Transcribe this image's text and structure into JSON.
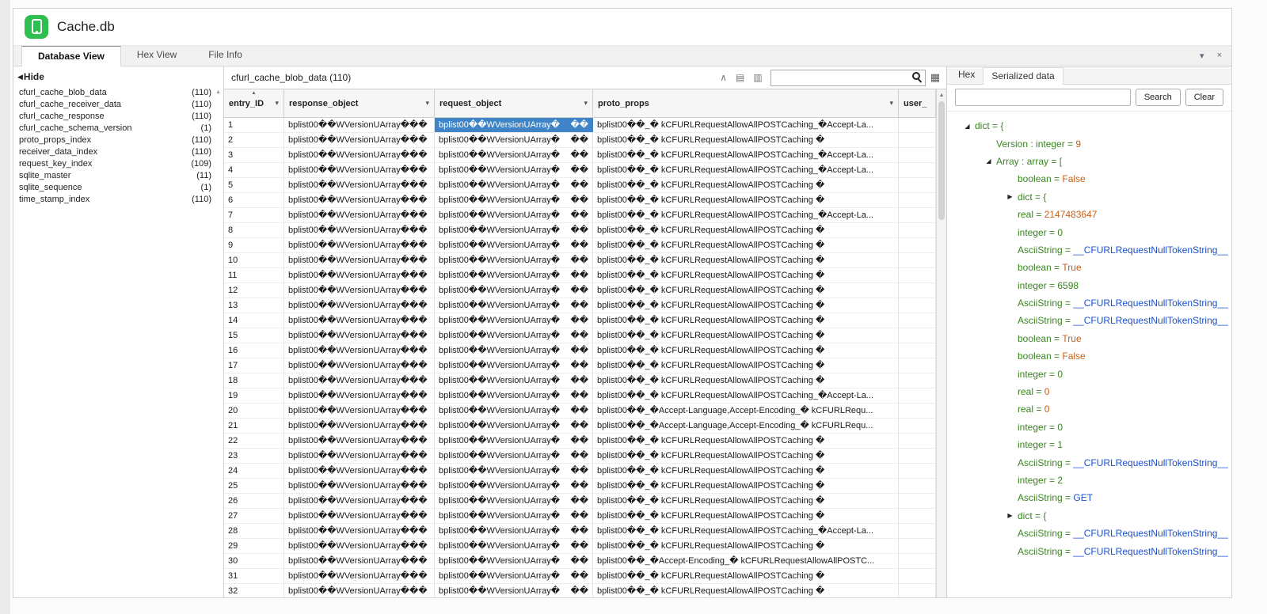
{
  "window": {
    "title": "Cache.db"
  },
  "tabs": [
    {
      "label": "Database View",
      "active": true
    },
    {
      "label": "Hex View",
      "active": false
    },
    {
      "label": "File Info",
      "active": false
    }
  ],
  "sidebar": {
    "hide_label": "Hide",
    "tables": [
      {
        "name": "cfurl_cache_blob_data",
        "count": "(110)"
      },
      {
        "name": "cfurl_cache_receiver_data",
        "count": "(110)"
      },
      {
        "name": "cfurl_cache_response",
        "count": "(110)"
      },
      {
        "name": "cfurl_cache_schema_version",
        "count": "(1)"
      },
      {
        "name": "proto_props_index",
        "count": "(110)"
      },
      {
        "name": "receiver_data_index",
        "count": "(110)"
      },
      {
        "name": "request_key_index",
        "count": "(109)"
      },
      {
        "name": "sqlite_master",
        "count": "(11)"
      },
      {
        "name": "sqlite_sequence",
        "count": "(1)"
      },
      {
        "name": "time_stamp_index",
        "count": "(110)"
      }
    ]
  },
  "grid": {
    "title": "cfurl_cache_blob_data (110)",
    "search_value": "",
    "columns": [
      {
        "label": "entry_ID",
        "sorted": true,
        "arrow": true
      },
      {
        "label": "response_object",
        "sorted": false,
        "arrow": true
      },
      {
        "label": "request_object",
        "sorted": false,
        "arrow": true
      },
      {
        "label": "proto_props",
        "sorted": false,
        "arrow": true
      },
      {
        "label": "user_",
        "sorted": false,
        "arrow": false
      }
    ],
    "selected": {
      "row_id": "1",
      "column": "request_object"
    },
    "rows": [
      {
        "id": "1",
        "response": "bplist00��WVersionUArray���",
        "request": "bplist00��WVersionUArray�",
        "request_tail": "��",
        "proto": "bplist00��_� kCFURLRequestAllowAllPOSTCaching_�Accept-La...",
        "user": ""
      },
      {
        "id": "2",
        "response": "bplist00��WVersionUArray���",
        "request": "bplist00��WVersionUArray�",
        "request_tail": "��",
        "proto": "bplist00��_� kCFURLRequestAllowAllPOSTCaching �",
        "user": ""
      },
      {
        "id": "3",
        "response": "bplist00��WVersionUArray���",
        "request": "bplist00��WVersionUArray�",
        "request_tail": "��",
        "proto": "bplist00��_� kCFURLRequestAllowAllPOSTCaching_�Accept-La...",
        "user": ""
      },
      {
        "id": "4",
        "response": "bplist00��WVersionUArray���",
        "request": "bplist00��WVersionUArray�",
        "request_tail": "��",
        "proto": "bplist00��_� kCFURLRequestAllowAllPOSTCaching_�Accept-La...",
        "user": ""
      },
      {
        "id": "5",
        "response": "bplist00��WVersionUArray���",
        "request": "bplist00��WVersionUArray�",
        "request_tail": "��",
        "proto": "bplist00��_� kCFURLRequestAllowAllPOSTCaching �",
        "user": ""
      },
      {
        "id": "6",
        "response": "bplist00��WVersionUArray���",
        "request": "bplist00��WVersionUArray�",
        "request_tail": "��",
        "proto": "bplist00��_� kCFURLRequestAllowAllPOSTCaching �",
        "user": ""
      },
      {
        "id": "7",
        "response": "bplist00��WVersionUArray���",
        "request": "bplist00��WVersionUArray�",
        "request_tail": "��",
        "proto": "bplist00��_� kCFURLRequestAllowAllPOSTCaching_�Accept-La...",
        "user": ""
      },
      {
        "id": "8",
        "response": "bplist00��WVersionUArray���",
        "request": "bplist00��WVersionUArray�",
        "request_tail": "��",
        "proto": "bplist00��_� kCFURLRequestAllowAllPOSTCaching �",
        "user": ""
      },
      {
        "id": "9",
        "response": "bplist00��WVersionUArray���",
        "request": "bplist00��WVersionUArray�",
        "request_tail": "��",
        "proto": "bplist00��_� kCFURLRequestAllowAllPOSTCaching �",
        "user": ""
      },
      {
        "id": "10",
        "response": "bplist00��WVersionUArray���",
        "request": "bplist00��WVersionUArray�",
        "request_tail": "��",
        "proto": "bplist00��_� kCFURLRequestAllowAllPOSTCaching �",
        "user": ""
      },
      {
        "id": "11",
        "response": "bplist00��WVersionUArray���",
        "request": "bplist00��WVersionUArray�",
        "request_tail": "��",
        "proto": "bplist00��_� kCFURLRequestAllowAllPOSTCaching �",
        "user": ""
      },
      {
        "id": "12",
        "response": "bplist00��WVersionUArray���",
        "request": "bplist00��WVersionUArray�",
        "request_tail": "��",
        "proto": "bplist00��_� kCFURLRequestAllowAllPOSTCaching �",
        "user": ""
      },
      {
        "id": "13",
        "response": "bplist00��WVersionUArray���",
        "request": "bplist00��WVersionUArray�",
        "request_tail": "��",
        "proto": "bplist00��_� kCFURLRequestAllowAllPOSTCaching �",
        "user": ""
      },
      {
        "id": "14",
        "response": "bplist00��WVersionUArray���",
        "request": "bplist00��WVersionUArray�",
        "request_tail": "��",
        "proto": "bplist00��_� kCFURLRequestAllowAllPOSTCaching �",
        "user": ""
      },
      {
        "id": "15",
        "response": "bplist00��WVersionUArray���",
        "request": "bplist00��WVersionUArray�",
        "request_tail": "��",
        "proto": "bplist00��_� kCFURLRequestAllowAllPOSTCaching �",
        "user": ""
      },
      {
        "id": "16",
        "response": "bplist00��WVersionUArray���",
        "request": "bplist00��WVersionUArray�",
        "request_tail": "��",
        "proto": "bplist00��_� kCFURLRequestAllowAllPOSTCaching �",
        "user": ""
      },
      {
        "id": "17",
        "response": "bplist00��WVersionUArray���",
        "request": "bplist00��WVersionUArray�",
        "request_tail": "��",
        "proto": "bplist00��_� kCFURLRequestAllowAllPOSTCaching �",
        "user": ""
      },
      {
        "id": "18",
        "response": "bplist00��WVersionUArray���",
        "request": "bplist00��WVersionUArray�",
        "request_tail": "��",
        "proto": "bplist00��_� kCFURLRequestAllowAllPOSTCaching �",
        "user": ""
      },
      {
        "id": "19",
        "response": "bplist00��WVersionUArray���",
        "request": "bplist00��WVersionUArray�",
        "request_tail": "��",
        "proto": "bplist00��_� kCFURLRequestAllowAllPOSTCaching_�Accept-La...",
        "user": ""
      },
      {
        "id": "20",
        "response": "bplist00��WVersionUArray���",
        "request": "bplist00��WVersionUArray�",
        "request_tail": "��",
        "proto": "bplist00��_�Accept-Language,Accept-Encoding_� kCFURLRequ...",
        "user": ""
      },
      {
        "id": "21",
        "response": "bplist00��WVersionUArray���",
        "request": "bplist00��WVersionUArray�",
        "request_tail": "��",
        "proto": "bplist00��_�Accept-Language,Accept-Encoding_� kCFURLRequ...",
        "user": ""
      },
      {
        "id": "22",
        "response": "bplist00��WVersionUArray���",
        "request": "bplist00��WVersionUArray�",
        "request_tail": "��",
        "proto": "bplist00��_� kCFURLRequestAllowAllPOSTCaching �",
        "user": ""
      },
      {
        "id": "23",
        "response": "bplist00��WVersionUArray���",
        "request": "bplist00��WVersionUArray�",
        "request_tail": "��",
        "proto": "bplist00��_� kCFURLRequestAllowAllPOSTCaching �",
        "user": ""
      },
      {
        "id": "24",
        "response": "bplist00��WVersionUArray���",
        "request": "bplist00��WVersionUArray�",
        "request_tail": "��",
        "proto": "bplist00��_� kCFURLRequestAllowAllPOSTCaching �",
        "user": ""
      },
      {
        "id": "25",
        "response": "bplist00��WVersionUArray���",
        "request": "bplist00��WVersionUArray�",
        "request_tail": "��",
        "proto": "bplist00��_� kCFURLRequestAllowAllPOSTCaching �",
        "user": ""
      },
      {
        "id": "26",
        "response": "bplist00��WVersionUArray���",
        "request": "bplist00��WVersionUArray�",
        "request_tail": "��",
        "proto": "bplist00��_� kCFURLRequestAllowAllPOSTCaching �",
        "user": ""
      },
      {
        "id": "27",
        "response": "bplist00��WVersionUArray���",
        "request": "bplist00��WVersionUArray�",
        "request_tail": "��",
        "proto": "bplist00��_� kCFURLRequestAllowAllPOSTCaching �",
        "user": ""
      },
      {
        "id": "28",
        "response": "bplist00��WVersionUArray���",
        "request": "bplist00��WVersionUArray�",
        "request_tail": "��",
        "proto": "bplist00��_� kCFURLRequestAllowAllPOSTCaching_�Accept-La...",
        "user": ""
      },
      {
        "id": "29",
        "response": "bplist00��WVersionUArray���",
        "request": "bplist00��WVersionUArray�",
        "request_tail": "��",
        "proto": "bplist00��_� kCFURLRequestAllowAllPOSTCaching �",
        "user": ""
      },
      {
        "id": "30",
        "response": "bplist00��WVersionUArray���",
        "request": "bplist00��WVersionUArray�",
        "request_tail": "��",
        "proto": "bplist00��_�Accept-Encoding_� kCFURLRequestAllowAllPOSTC...",
        "user": ""
      },
      {
        "id": "31",
        "response": "bplist00��WVersionUArray���",
        "request": "bplist00��WVersionUArray�",
        "request_tail": "��",
        "proto": "bplist00��_� kCFURLRequestAllowAllPOSTCaching �",
        "user": ""
      },
      {
        "id": "32",
        "response": "bplist00��WVersionUArray���",
        "request": "bplist00��WVersionUArray�",
        "request_tail": "��",
        "proto": "bplist00��_� kCFURLRequestAllowAllPOSTCaching �",
        "user": ""
      }
    ]
  },
  "right_panel": {
    "tabs": [
      {
        "label": "Hex",
        "active": false
      },
      {
        "label": "Serialized data",
        "active": true
      }
    ],
    "search": {
      "value": "",
      "search_label": "Search",
      "clear_label": "Clear"
    },
    "tree": {
      "items": [
        {
          "indent": 0,
          "expander": "open",
          "text": "dict = {"
        },
        {
          "indent": 1,
          "expander": null,
          "text": "Version : integer = ",
          "value": "9",
          "color": "orange"
        },
        {
          "indent": 1,
          "expander": "open",
          "text": "Array : array = ["
        },
        {
          "indent": 2,
          "expander": null,
          "text": "boolean = ",
          "value": "False",
          "color": "orange"
        },
        {
          "indent": 2,
          "expander": "closed",
          "text": "dict = {"
        },
        {
          "indent": 2,
          "expander": null,
          "text": "real = ",
          "value": "2147483647",
          "color": "orange"
        },
        {
          "indent": 2,
          "expander": null,
          "text": "integer = ",
          "value": "0",
          "color": "green"
        },
        {
          "indent": 2,
          "expander": null,
          "text": "AsciiString = ",
          "value": "__CFURLRequestNullTokenString__",
          "color": "blue"
        },
        {
          "indent": 2,
          "expander": null,
          "text": "boolean = ",
          "value": "True",
          "color": "orange"
        },
        {
          "indent": 2,
          "expander": null,
          "text": "integer = ",
          "value": "6598",
          "color": "green"
        },
        {
          "indent": 2,
          "expander": null,
          "text": "AsciiString = ",
          "value": "__CFURLRequestNullTokenString__",
          "color": "blue"
        },
        {
          "indent": 2,
          "expander": null,
          "text": "AsciiString = ",
          "value": "__CFURLRequestNullTokenString__",
          "color": "blue"
        },
        {
          "indent": 2,
          "expander": null,
          "text": "boolean = ",
          "value": "True",
          "color": "orange"
        },
        {
          "indent": 2,
          "expander": null,
          "text": "boolean = ",
          "value": "False",
          "color": "orange"
        },
        {
          "indent": 2,
          "expander": null,
          "text": "integer = ",
          "value": "0",
          "color": "green"
        },
        {
          "indent": 2,
          "expander": null,
          "text": "real = ",
          "value": "0",
          "color": "orange"
        },
        {
          "indent": 2,
          "expander": null,
          "text": "real = ",
          "value": "0",
          "color": "orange"
        },
        {
          "indent": 2,
          "expander": null,
          "text": "integer = ",
          "value": "0",
          "color": "green"
        },
        {
          "indent": 2,
          "expander": null,
          "text": "integer = ",
          "value": "1",
          "color": "green"
        },
        {
          "indent": 2,
          "expander": null,
          "text": "AsciiString = ",
          "value": "__CFURLRequestNullTokenString__",
          "color": "blue"
        },
        {
          "indent": 2,
          "expander": null,
          "text": "integer = ",
          "value": "2",
          "color": "green"
        },
        {
          "indent": 2,
          "expander": null,
          "text": "AsciiString = ",
          "value": "GET",
          "color": "blue"
        },
        {
          "indent": 2,
          "expander": "closed",
          "text": "dict = {"
        },
        {
          "indent": 2,
          "expander": null,
          "text": "AsciiString = ",
          "value": "__CFURLRequestNullTokenString__",
          "color": "blue"
        },
        {
          "indent": 2,
          "expander": null,
          "text": "AsciiString = ",
          "value": "__CFURLRequestNullTokenString__",
          "color": "blue"
        }
      ]
    }
  },
  "icons": {
    "sidebar_collapse": "◀",
    "panel_dropdown": "▾",
    "close": "×",
    "toolbar_caret": "∧",
    "toolbar_grid1": "▤",
    "toolbar_grid2": "▥",
    "search": "magnifier",
    "filter_grid": "▦",
    "scroll_up": "▲",
    "header_dropdown": "▾",
    "sort_asc": "▴",
    "tree_open": "◢",
    "tree_closed": "▶",
    "app_icon": "smartphone"
  },
  "colors": {
    "selection_blue": "#3e84c6",
    "app_icon_green": "#2fbf50",
    "tree_key_green": "#3a8422",
    "value_orange": "#c75f17",
    "value_blue": "#1c50cc",
    "value_green": "#3a8422"
  }
}
